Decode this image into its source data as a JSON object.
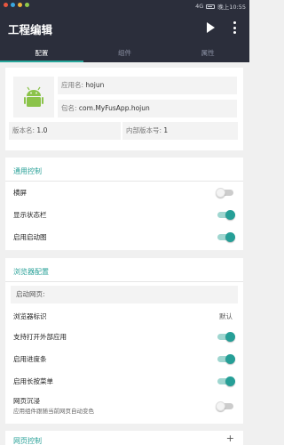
{
  "status_bar": {
    "time": "晚上10:55",
    "signal": "4G",
    "battery": "battery-icon"
  },
  "app_bar": {
    "title": "工程编辑",
    "play_icon": "play-icon",
    "more_icon": "more-vert-icon"
  },
  "tabs": [
    {
      "label": "配置",
      "active": true
    },
    {
      "label": "组件",
      "active": false
    },
    {
      "label": "属性",
      "active": false
    }
  ],
  "app_info": {
    "name_label": "应用名:",
    "name_value": "hojun",
    "package_label": "包名:",
    "package_value": "com.MyFusApp.hojun",
    "version_name_label": "版本名:",
    "version_name_value": "1.0",
    "version_code_label": "内部版本号:",
    "version_code_value": "1"
  },
  "general": {
    "title": "通用控制",
    "rows": [
      {
        "label": "横屏",
        "on": false
      },
      {
        "label": "显示状态栏",
        "on": true
      },
      {
        "label": "启用启动图",
        "on": true
      }
    ]
  },
  "browser": {
    "title": "浏览器配置",
    "start_page_placeholder": "启动网页:",
    "ua_label": "浏览器标识",
    "ua_value": "默认",
    "rows": [
      {
        "label": "支持打开外部应用",
        "on": true
      },
      {
        "label": "启用进度条",
        "on": true
      },
      {
        "label": "启用长按菜单",
        "on": true
      }
    ],
    "immersive_label": "网页沉浸",
    "immersive_sub": "应用组件跟随当前网页自动变色",
    "immersive_on": false
  },
  "next_section": {
    "title": "网页控制",
    "add": "+"
  },
  "colors": {
    "accent": "#26a69a",
    "appbar": "#2b2e3b"
  }
}
